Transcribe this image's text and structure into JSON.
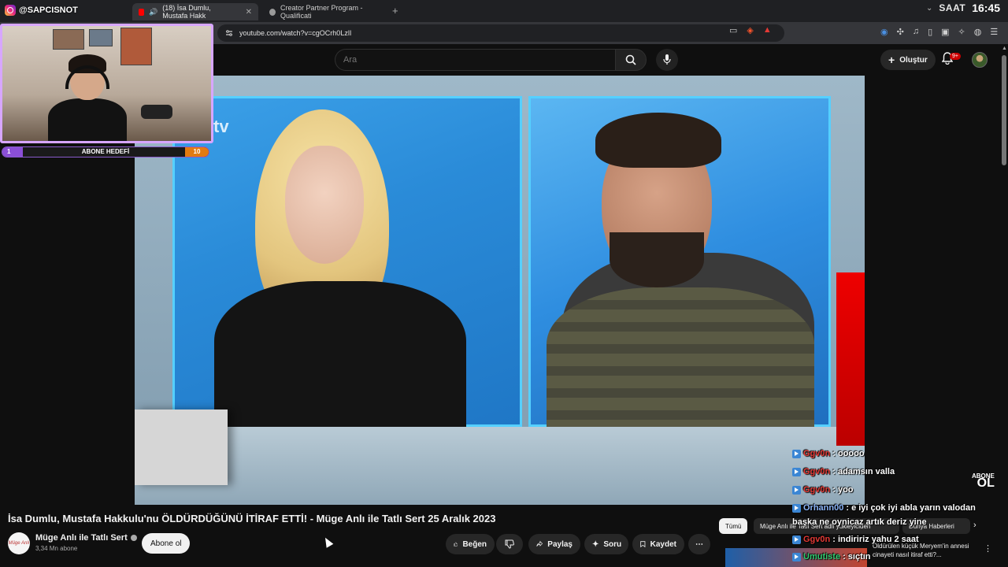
{
  "browser": {
    "tabs": [
      {
        "label": "(18) İsa Dumlu, Mustafa Hakk",
        "active": true
      },
      {
        "label": "Creator Partner Program - Qualificati",
        "active": false
      }
    ],
    "url": "youtube.com/watch?v=cgOCrh0LzlI",
    "clock_label": "SAAT",
    "time": "16:45"
  },
  "youtube": {
    "search_placeholder": "Ara",
    "create_label": "Oluştur",
    "notif_badge": "9+"
  },
  "overlay": {
    "instagram_handle": "@SAPCISNOT",
    "goal": {
      "label": "ABONE HEDEFİ",
      "current": "1",
      "target": "10",
      "progress": 0.1
    },
    "abone_ol_small": "ABONE",
    "abone_ol_big": "OL"
  },
  "video": {
    "channel_watermark": "tv",
    "title": "İsa Dumlu, Mustafa Hakkulu'nu ÖLDÜRDÜĞÜNÜ İTİRAF ETTİ! - Müge Anlı ile Tatlı Sert 25 Aralık 2023",
    "channel_name": "Müge Anlı ile Tatlı Sert",
    "channel_avatar_text": "Müge Anlı",
    "subscribers": "3,34 Mn abone",
    "subscribe_label": "Abone ol",
    "actions": {
      "like": "Beğen",
      "share": "Paylaş",
      "ask": "Soru",
      "save": "Kaydet"
    }
  },
  "sidebar": {
    "chips": [
      "Tümü",
      "Müge Anlı ile Tatlı Sert adlı yükleyiciden",
      "Dünya Haberleri"
    ],
    "recommendation_title": "Öldürülen küçük Meryem'in annesi cinayeti nasıl itiraf etti?..."
  },
  "chat": [
    {
      "user": "Ggv0n",
      "color": "#e53935",
      "message": ": ooooo"
    },
    {
      "user": "Ggv0n",
      "color": "#e53935",
      "message": ": adamsın valla"
    },
    {
      "user": "Ggv0n",
      "color": "#e53935",
      "message": ": yoo"
    },
    {
      "user": "Orhann00",
      "color": "#8ab4f8",
      "message": ": e iyi çok iyi abla yarın valodan"
    },
    {
      "user": "",
      "color": "#ffffff",
      "message": "başka ne oynicaz artık deriz yine"
    },
    {
      "user": "Ggv0n",
      "color": "#e53935",
      "message": ": indiririz yahu 2 saat"
    },
    {
      "user": "Umutiste",
      "color": "#2ecc71",
      "message": ": sıçtın"
    }
  ],
  "colors": {
    "youtube_bg": "#0f0f0f",
    "webcam_border": "#d7a6ff",
    "goal_fill": "#8b4fd6",
    "goal_end": "#e27b12",
    "studio_blue": "#2a8bd8"
  }
}
